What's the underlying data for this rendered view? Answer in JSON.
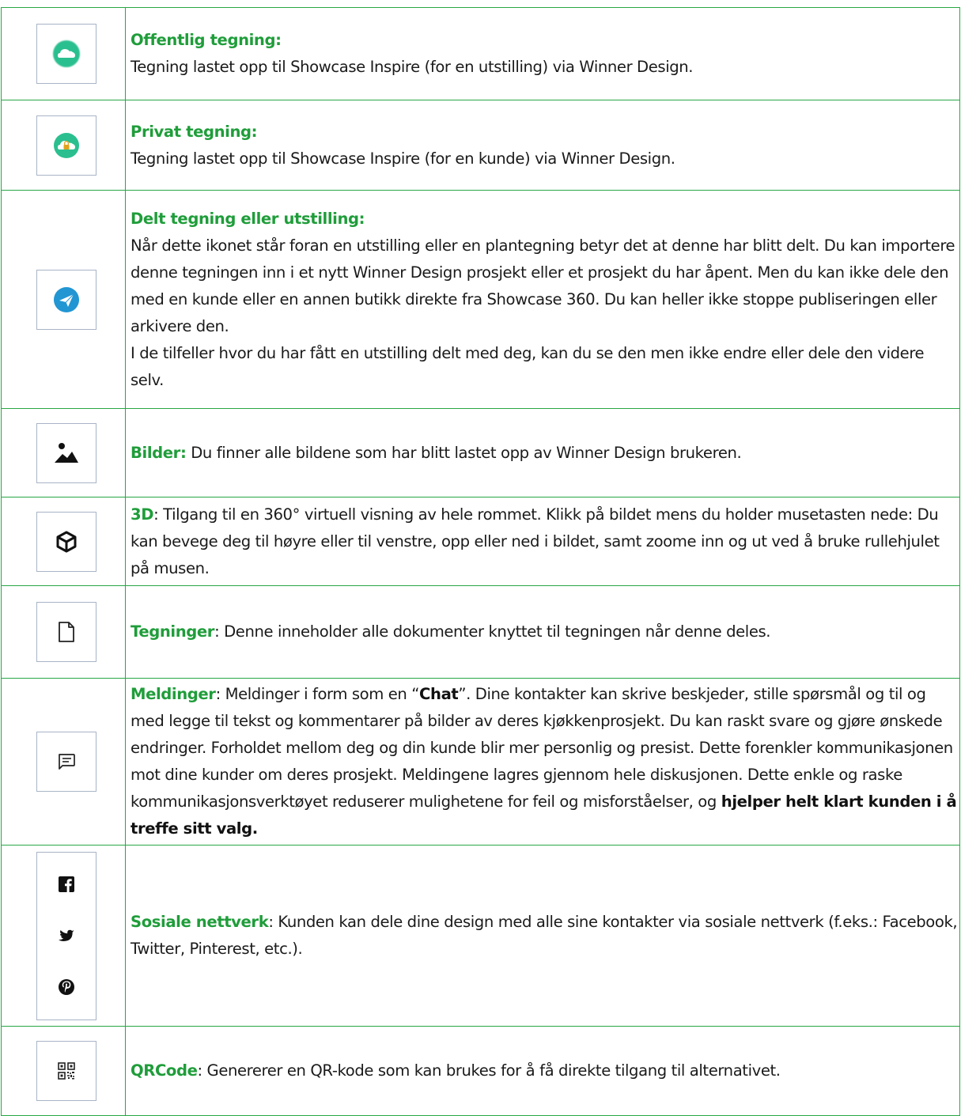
{
  "rows": [
    {
      "icon": "cloud-icon",
      "title": "Offentlig tegning:",
      "text": "Tegning lastet opp til Showcase Inspire (for en utstilling) via Winner Design."
    },
    {
      "icon": "cloud-lock-icon",
      "title": "Privat tegning:",
      "text": "Tegning lastet opp til Showcase Inspire (for en kunde) via Winner Design."
    },
    {
      "icon": "paper-plane-icon",
      "title": "Delt tegning eller utstilling:",
      "para1": "Når dette ikonet står foran en utstilling eller en plantegning betyr det at denne har blitt delt. Du kan importere denne tegningen inn i et nytt Winner Design prosjekt eller et prosjekt du har åpent. Men du kan ikke dele den med en kunde eller en annen butikk direkte fra Showcase 360. Du kan heller ikke stoppe publiseringen eller arkivere den.",
      "para2": "I de tilfeller hvor du har fått en utstilling delt med deg, kan du se den men ikke endre eller dele den videre selv."
    },
    {
      "icon": "image-icon",
      "title": "Bilder:",
      "text": " Du finner alle bildene som har blitt lastet opp av Winner Design brukeren."
    },
    {
      "icon": "cube-icon",
      "title": "3D",
      "text": ": Tilgang til en 360° virtuell visning av hele rommet. Klikk på bildet mens du holder musetasten nede: Du kan bevege deg til høyre eller til venstre, opp eller ned i bildet, samt zoome inn og ut ved å bruke rullehjulet på musen."
    },
    {
      "icon": "document-icon",
      "title": "Tegninger",
      "text": ": Denne inneholder alle dokumenter knyttet til tegningen når denne deles."
    },
    {
      "icon": "message-icon",
      "title": "Meldinger",
      "text_a": ": Meldinger i form som en “",
      "bold_chat": "Chat",
      "text_b": "”. Dine kontakter kan skrive beskjeder, stille spørsmål og til og med legge til tekst og kommentarer på bilder av deres kjøkkenprosjekt. Du kan raskt svare og gjøre ønskede endringer. Forholdet mellom deg og din kunde blir mer personlig og presist. Dette forenkler kommunikasjonen mot dine kunder om deres prosjekt. Meldingene lagres gjennom hele diskusjonen. Dette enkle og raske kommunikasjonsverktøyet reduserer mulighetene for feil og misforståelser, og ",
      "bold_end": "hjelper helt klart kunden i å treffe sitt valg."
    },
    {
      "icons": [
        "facebook-icon",
        "twitter-icon",
        "pinterest-icon"
      ],
      "title": "Sosiale nettverk",
      "text": ": Kunden kan dele dine design med alle sine kontakter via sosiale nettverk (f.eks.: Facebook, Twitter, Pinterest, etc.)."
    },
    {
      "icon": "qr-code-icon",
      "title": "QRCode",
      "text": ": Genererer en QR-kode som kan brukes for å få direkte tilgang til alternativet."
    }
  ],
  "colors": {
    "title_green": "#1f9d3a",
    "border_green": "#28a745",
    "cloud_teal": "#2bbf8f",
    "plane_blue": "#2196d3"
  }
}
